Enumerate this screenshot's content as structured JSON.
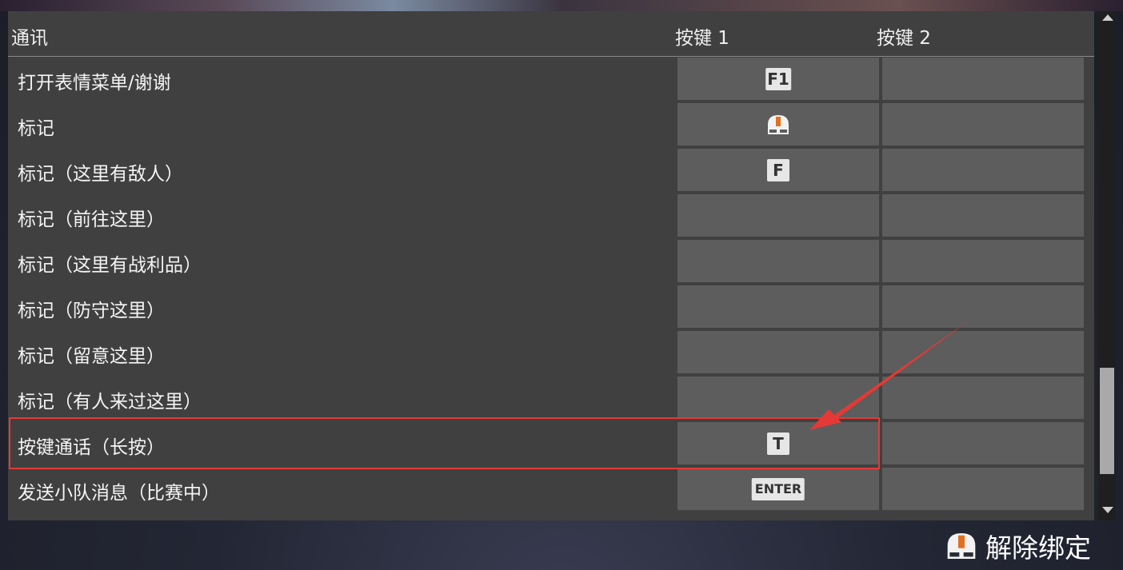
{
  "header": {
    "section": "通讯",
    "key1": "按键 1",
    "key2": "按键 2"
  },
  "rows": [
    {
      "label": "打开表情菜单/谢谢",
      "key1": "F1",
      "key1_type": "key"
    },
    {
      "label": "标记",
      "key1": "mouse-icon",
      "key1_type": "mouse"
    },
    {
      "label": "标记（这里有敌人）",
      "key1": "F",
      "key1_type": "key"
    },
    {
      "label": "标记（前往这里）",
      "key1": "",
      "key1_type": "none"
    },
    {
      "label": "标记（这里有战利品）",
      "key1": "",
      "key1_type": "none"
    },
    {
      "label": "标记（防守这里）",
      "key1": "",
      "key1_type": "none"
    },
    {
      "label": "标记（留意这里）",
      "key1": "",
      "key1_type": "none"
    },
    {
      "label": "标记（有人来过这里）",
      "key1": "",
      "key1_type": "none"
    },
    {
      "label": "按键通话（长按）",
      "key1": "T",
      "key1_type": "key"
    },
    {
      "label": "发送小队消息（比赛中）",
      "key1": "ENTER",
      "key1_type": "key"
    }
  ],
  "footer": {
    "unbind_label": "解除绑定",
    "unbind_icon": "mouse-icon"
  },
  "colors": {
    "highlight": "#e53935",
    "mouse_accent": "#e07020"
  }
}
